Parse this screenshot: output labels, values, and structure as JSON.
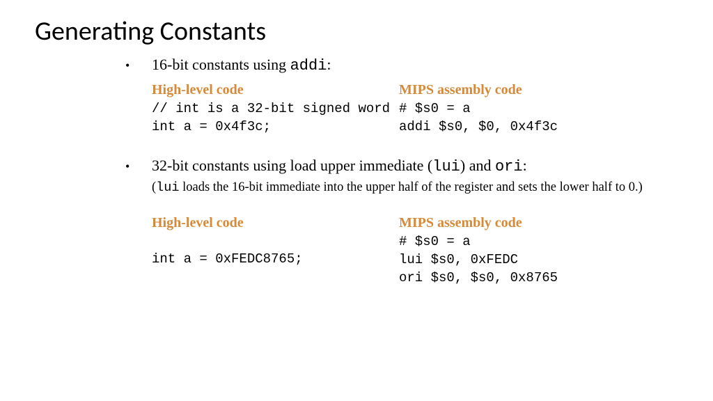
{
  "title": "Generating Constants",
  "bullet1": {
    "text_prefix": "16-bit constants using ",
    "code": "addi",
    "text_suffix": ":"
  },
  "section1": {
    "left_label": "High-level code",
    "left_code": "// int is a 32-bit signed word\nint a = 0x4f3c;",
    "right_label": "MIPS assembly code",
    "right_code": "# $s0 = a\naddi $s0, $0, 0x4f3c"
  },
  "bullet2": {
    "text_prefix": "32-bit constants using load upper immediate (",
    "code1": "lui",
    "mid": ") and ",
    "code2": "ori",
    "text_suffix": ":"
  },
  "note": {
    "prefix": "(",
    "code": "lui",
    "rest": " loads the 16-bit immediate into the upper half of the register and sets the lower half to 0.)"
  },
  "section2": {
    "left_label": "High-level code",
    "left_code": "int a = 0xFEDC8765;",
    "right_label": "MIPS assembly code",
    "right_code": "# $s0 = a\nlui $s0, 0xFEDC\nori $s0, $s0, 0x8765"
  }
}
